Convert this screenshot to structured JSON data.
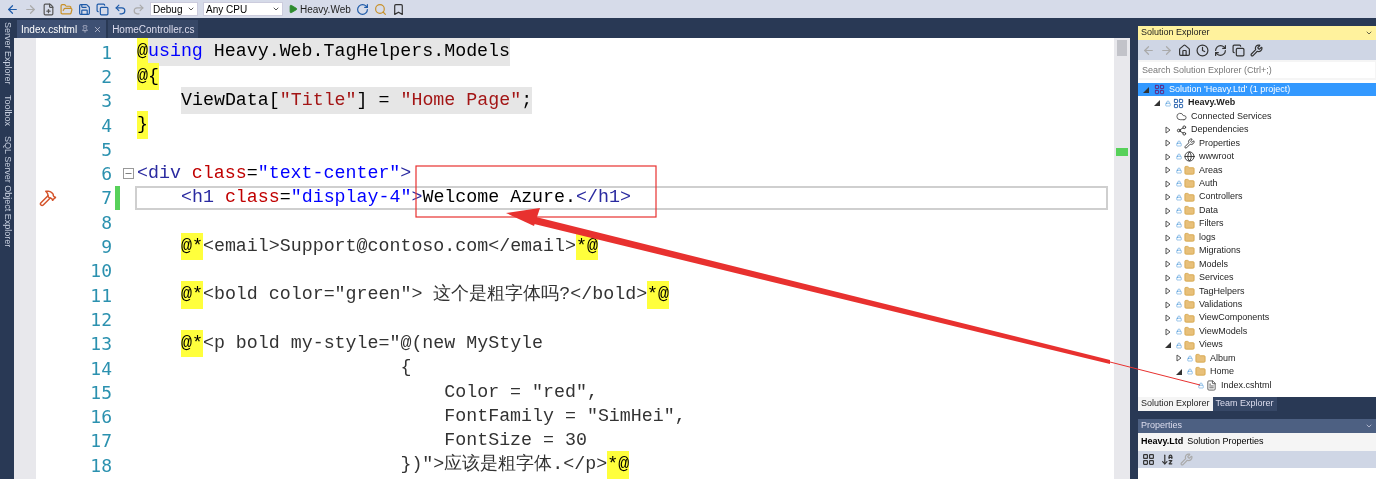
{
  "toolbar": {
    "configuration": "Debug",
    "platform": "Any CPU",
    "start_target": "Heavy.Web"
  },
  "side_tabs": [
    {
      "label": "Server Explorer"
    },
    {
      "label": "Toolbox"
    },
    {
      "label": "SQL Server Object Explorer"
    }
  ],
  "document_tabs": [
    {
      "label": "Index.cshtml",
      "selected": true
    },
    {
      "label": "HomeController.cs",
      "selected": false
    }
  ],
  "editor": {
    "lines": [
      {
        "number": "1",
        "indented": false,
        "shaded": true,
        "current": false,
        "changed": false,
        "segments": [
          {
            "kind": "razor",
            "text": "@"
          },
          {
            "kind": "keyword",
            "text": "using"
          },
          {
            "kind": "plain",
            "text": " Heavy.Web.TagHelpers.Models"
          }
        ]
      },
      {
        "number": "2",
        "indented": false,
        "current": false,
        "changed": false,
        "segments": [
          {
            "kind": "razor",
            "text": "@{"
          }
        ]
      },
      {
        "number": "3",
        "indented": true,
        "shaded": true,
        "current": false,
        "changed": false,
        "segments": [
          {
            "kind": "plain",
            "text": "ViewData["
          },
          {
            "kind": "csstring",
            "text": "\"Title\""
          },
          {
            "kind": "plain",
            "text": "] = "
          },
          {
            "kind": "csstring",
            "text": "\"Home Page\""
          },
          {
            "kind": "plain",
            "text": ";"
          }
        ]
      },
      {
        "number": "4",
        "indented": false,
        "current": false,
        "changed": false,
        "segments": [
          {
            "kind": "razor",
            "text": "}"
          }
        ]
      },
      {
        "number": "5",
        "indented": false,
        "current": false,
        "changed": false
      },
      {
        "number": "6",
        "indented": false,
        "shaded": false,
        "current": false,
        "changed": false,
        "fold_expanded": true,
        "segments": [
          {
            "kind": "tag",
            "text": "<div"
          },
          {
            "kind": "attr",
            "text": " class"
          },
          {
            "kind": "plain",
            "text": "="
          },
          {
            "kind": "attrvalue",
            "text": "\"text-center\""
          },
          {
            "kind": "tag",
            "text": ">"
          }
        ]
      },
      {
        "number": "7",
        "indented": true,
        "shaded": false,
        "current": true,
        "changed": true,
        "marker": true,
        "segments": [
          {
            "kind": "tag",
            "text": "<h1"
          },
          {
            "kind": "attr",
            "text": " class"
          },
          {
            "kind": "plain",
            "text": "="
          },
          {
            "kind": "attrvalue",
            "text": "\"display-4\""
          },
          {
            "kind": "tag",
            "text": ">"
          },
          {
            "kind": "plain",
            "text": "Welcome Azure."
          },
          {
            "kind": "tag",
            "text": "</h1>"
          }
        ]
      },
      {
        "number": "8",
        "indented": false,
        "current": false,
        "changed": false
      },
      {
        "number": "9",
        "indented": true,
        "shaded": false,
        "current": false,
        "changed": false,
        "segments": [
          {
            "kind": "razor",
            "text": "@*"
          },
          {
            "kind": "comment",
            "text": "<email>Support@contoso.com</email>"
          },
          {
            "kind": "razor",
            "text": "*@"
          }
        ]
      },
      {
        "number": "10",
        "indented": false,
        "current": false,
        "changed": false
      },
      {
        "number": "11",
        "indented": true,
        "shaded": false,
        "current": false,
        "changed": false,
        "segments": [
          {
            "kind": "razor",
            "text": "@*"
          },
          {
            "kind": "comment",
            "text": "<bold color=\"green\"> 这个是粗字体吗?</bold>"
          },
          {
            "kind": "razor",
            "text": "*@"
          }
        ]
      },
      {
        "number": "12",
        "indented": false,
        "current": false,
        "changed": false
      },
      {
        "number": "13",
        "indented": true,
        "shaded": false,
        "current": false,
        "changed": false,
        "segments": [
          {
            "kind": "razor",
            "text": "@*"
          },
          {
            "kind": "comment",
            "text": "<p bold my-style=\"@(new MyStyle"
          }
        ]
      },
      {
        "number": "14",
        "indented": true,
        "shaded": false,
        "current": false,
        "changed": false,
        "segments": [
          {
            "kind": "comment",
            "text": "                    {"
          }
        ]
      },
      {
        "number": "15",
        "indented": true,
        "shaded": false,
        "current": false,
        "changed": false,
        "segments": [
          {
            "kind": "comment",
            "text": "                        Color = \"red\","
          }
        ]
      },
      {
        "number": "16",
        "indented": true,
        "shaded": false,
        "current": false,
        "changed": false,
        "segments": [
          {
            "kind": "comment",
            "text": "                        FontFamily = \"SimHei\","
          }
        ]
      },
      {
        "number": "17",
        "indented": true,
        "shaded": false,
        "current": false,
        "changed": false,
        "segments": [
          {
            "kind": "comment",
            "text": "                        FontSize = 30"
          }
        ]
      },
      {
        "number": "18",
        "indented": true,
        "shaded": false,
        "current": false,
        "changed": false,
        "segments": [
          {
            "kind": "comment",
            "text": "                    })\">应该是粗字体.</p>"
          },
          {
            "kind": "razor",
            "text": "*@"
          }
        ]
      }
    ]
  },
  "solution_explorer": {
    "title": "Solution Explorer",
    "search": {
      "placeholder": "Search Solution Explorer (Ctrl+;)"
    },
    "tree": [
      {
        "label": "Solution 'Heavy.Ltd' (1 project)",
        "kind": "solution",
        "selected": true,
        "expanded": true,
        "children": [
          {
            "label": "Heavy.Web",
            "kind": "project",
            "selected": false,
            "expanded": true,
            "children": [
              {
                "label": "Connected Services",
                "kind": "service",
                "selected": false
              },
              {
                "label": "Dependencies",
                "kind": "dependencies",
                "selected": false,
                "expanded": false
              },
              {
                "label": "Properties",
                "kind": "properties",
                "selected": false,
                "expanded": false
              },
              {
                "label": "wwwroot",
                "kind": "web",
                "selected": false,
                "expanded": false
              },
              {
                "label": "Areas",
                "kind": "folder",
                "selected": false,
                "expanded": false
              },
              {
                "label": "Auth",
                "kind": "folder",
                "selected": false,
                "expanded": false
              },
              {
                "label": "Controllers",
                "kind": "folder",
                "selected": false,
                "expanded": false
              },
              {
                "label": "Data",
                "kind": "folder",
                "selected": false,
                "expanded": false
              },
              {
                "label": "Filters",
                "kind": "folder",
                "selected": false,
                "expanded": false
              },
              {
                "label": "logs",
                "kind": "folder",
                "selected": false,
                "expanded": false
              },
              {
                "label": "Migrations",
                "kind": "folder",
                "selected": false,
                "expanded": false
              },
              {
                "label": "Models",
                "kind": "folder",
                "selected": false,
                "expanded": false
              },
              {
                "label": "Services",
                "kind": "folder",
                "selected": false,
                "expanded": false
              },
              {
                "label": "TagHelpers",
                "kind": "folder",
                "selected": false,
                "expanded": false
              },
              {
                "label": "Validations",
                "kind": "folder",
                "selected": false,
                "expanded": false
              },
              {
                "label": "ViewComponents",
                "kind": "folder",
                "selected": false,
                "expanded": false
              },
              {
                "label": "ViewModels",
                "kind": "folder",
                "selected": false,
                "expanded": false
              },
              {
                "label": "Views",
                "kind": "folder",
                "selected": false,
                "expanded": true,
                "children": [
                  {
                    "label": "Album",
                    "kind": "folder",
                    "selected": false,
                    "expanded": false
                  },
                  {
                    "label": "Home",
                    "kind": "folder",
                    "selected": false,
                    "expanded": true,
                    "children": [
                      {
                        "label": "Index.cshtml",
                        "kind": "file",
                        "selected": false
                      }
                    ]
                  }
                ]
              }
            ]
          }
        ]
      }
    ],
    "tabs": [
      {
        "label": "Solution Explorer",
        "selected": true
      },
      {
        "label": "Team Explorer",
        "selected": false
      }
    ]
  },
  "properties": {
    "title": "Properties",
    "object_name": "Heavy.Ltd",
    "object_type": "Solution Properties"
  }
}
